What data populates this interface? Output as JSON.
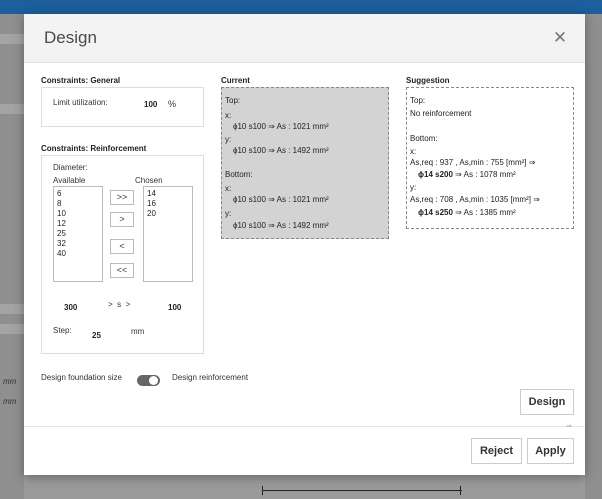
{
  "dialog": {
    "title": "Design",
    "close_icon": "close-icon"
  },
  "constraints_general": {
    "title": "Constraints:  General",
    "limit_label": "Limit utilization:",
    "limit_value": "100",
    "limit_unit": "%"
  },
  "constraints_reinforcement": {
    "title": "Constraints:  Reinforcement",
    "diameter_label": "Diameter:",
    "available_label": "Available",
    "chosen_label": "Chosen",
    "available": [
      "6",
      "8",
      "10",
      "12",
      "25",
      "32",
      "40"
    ],
    "chosen": [
      "14",
      "16",
      "20"
    ],
    "buttons": {
      "add_all": ">>",
      "add": ">",
      "remove": "<",
      "remove_all": "<<"
    },
    "spacing_min": "300",
    "spacing_mid": ">  s  >",
    "spacing_max": "100",
    "step_label": "Step:",
    "step_value": "25",
    "step_unit": "mm"
  },
  "current": {
    "title": "Current",
    "top": "Top:",
    "x": "x:",
    "y": "y:",
    "bottom": "Bottom:",
    "top_x": "ϕ10 s100  ⇒ As : 1021 mm²",
    "top_y": "ϕ10 s100  ⇒ As : 1492 mm²",
    "bottom_x": "ϕ10 s100  ⇒ As : 1021 mm²",
    "bottom_y": "ϕ10 s100  ⇒ As : 1492 mm²"
  },
  "suggestion": {
    "title": "Suggestion",
    "top": "Top:",
    "top_value": "No reinforcement",
    "bottom": "Bottom:",
    "x": "x:",
    "y": "y:",
    "x_req": "As,req : 937 , As,min : 755  [mm²]   ⇒",
    "x_result_bold": "ϕ14 s200",
    "x_result_rest": " ⇒ As : 1078 mm²",
    "y_req": "As,req : 708 , As,min : 1035  [mm²]   ⇒",
    "y_result_bold": "ϕ14 s250",
    "y_result_rest": " ⇒ As : 1385 mm²"
  },
  "options": {
    "design_foundation_size": "Design foundation size",
    "design_reinforcement": "Design reinforcement"
  },
  "actions": {
    "design": "Design",
    "reject": "Reject",
    "apply": "Apply"
  },
  "background": {
    "unit_1": "mm",
    "unit_2": "mm"
  }
}
